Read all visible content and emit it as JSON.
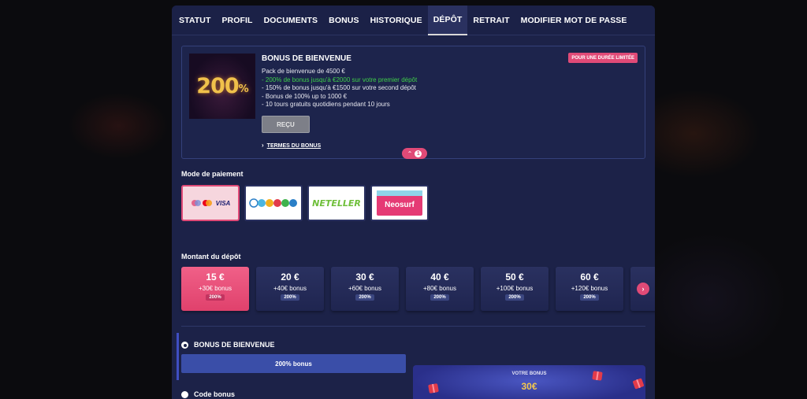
{
  "tabs": [
    "STATUT",
    "PROFIL",
    "DOCUMENTS",
    "BONUS",
    "HISTORIQUE",
    "DÉPÔT",
    "RETRAIT",
    "MODIFIER MOT DE PASSE"
  ],
  "active_tab": "DÉPÔT",
  "promo": {
    "image_big": "200",
    "image_pct": "%",
    "title": "BONUS DE BIENVENUE",
    "tag": "POUR UNE DURÉE LIMITÉE",
    "line1": "Pack de bienvenue de 4500 €",
    "line2": "- 200% de bonus jusqu'à €2000 sur votre premier dépôt",
    "line3": "- 150% de bonus jusqu'à €1500 sur votre second dépôt",
    "line4": "- Bonus de 100% up to 1000 €",
    "line5": "- 10 tours gratuits quotidiens pendant 10 jours",
    "received_label": "REÇU",
    "terms_label": "TERMES DU BONUS",
    "badge_count": "1"
  },
  "payment": {
    "label": "Mode de paiement",
    "visa_text": "VISA",
    "neteller_text": "NETELLER",
    "neosurf_text": "Neosurf"
  },
  "amounts": {
    "label": "Montant du dépôt",
    "items": [
      {
        "value": "15 €",
        "bonus": "+30€ bonus",
        "badge": "200%"
      },
      {
        "value": "20 €",
        "bonus": "+40€ bonus",
        "badge": "200%"
      },
      {
        "value": "30 €",
        "bonus": "+60€ bonus",
        "badge": "200%"
      },
      {
        "value": "40 €",
        "bonus": "+80€ bonus",
        "badge": "200%"
      },
      {
        "value": "50 €",
        "bonus": "+100€ bonus",
        "badge": "200%"
      },
      {
        "value": "60 €",
        "bonus": "+120€ bonus",
        "badge": "200%"
      }
    ]
  },
  "bonus_select": {
    "welcome_label": "BONUS DE BIENVENUE",
    "welcome_value": "200% bonus",
    "code_label": "Code bonus"
  },
  "your_bonus": {
    "label": "VOTRE BONUS",
    "amount": "30€"
  },
  "colors": {
    "panel": "#1c2248",
    "accent_pink": "#e04a77",
    "green_highlight": "#3fcf4a",
    "gold": "#f3c84f"
  }
}
